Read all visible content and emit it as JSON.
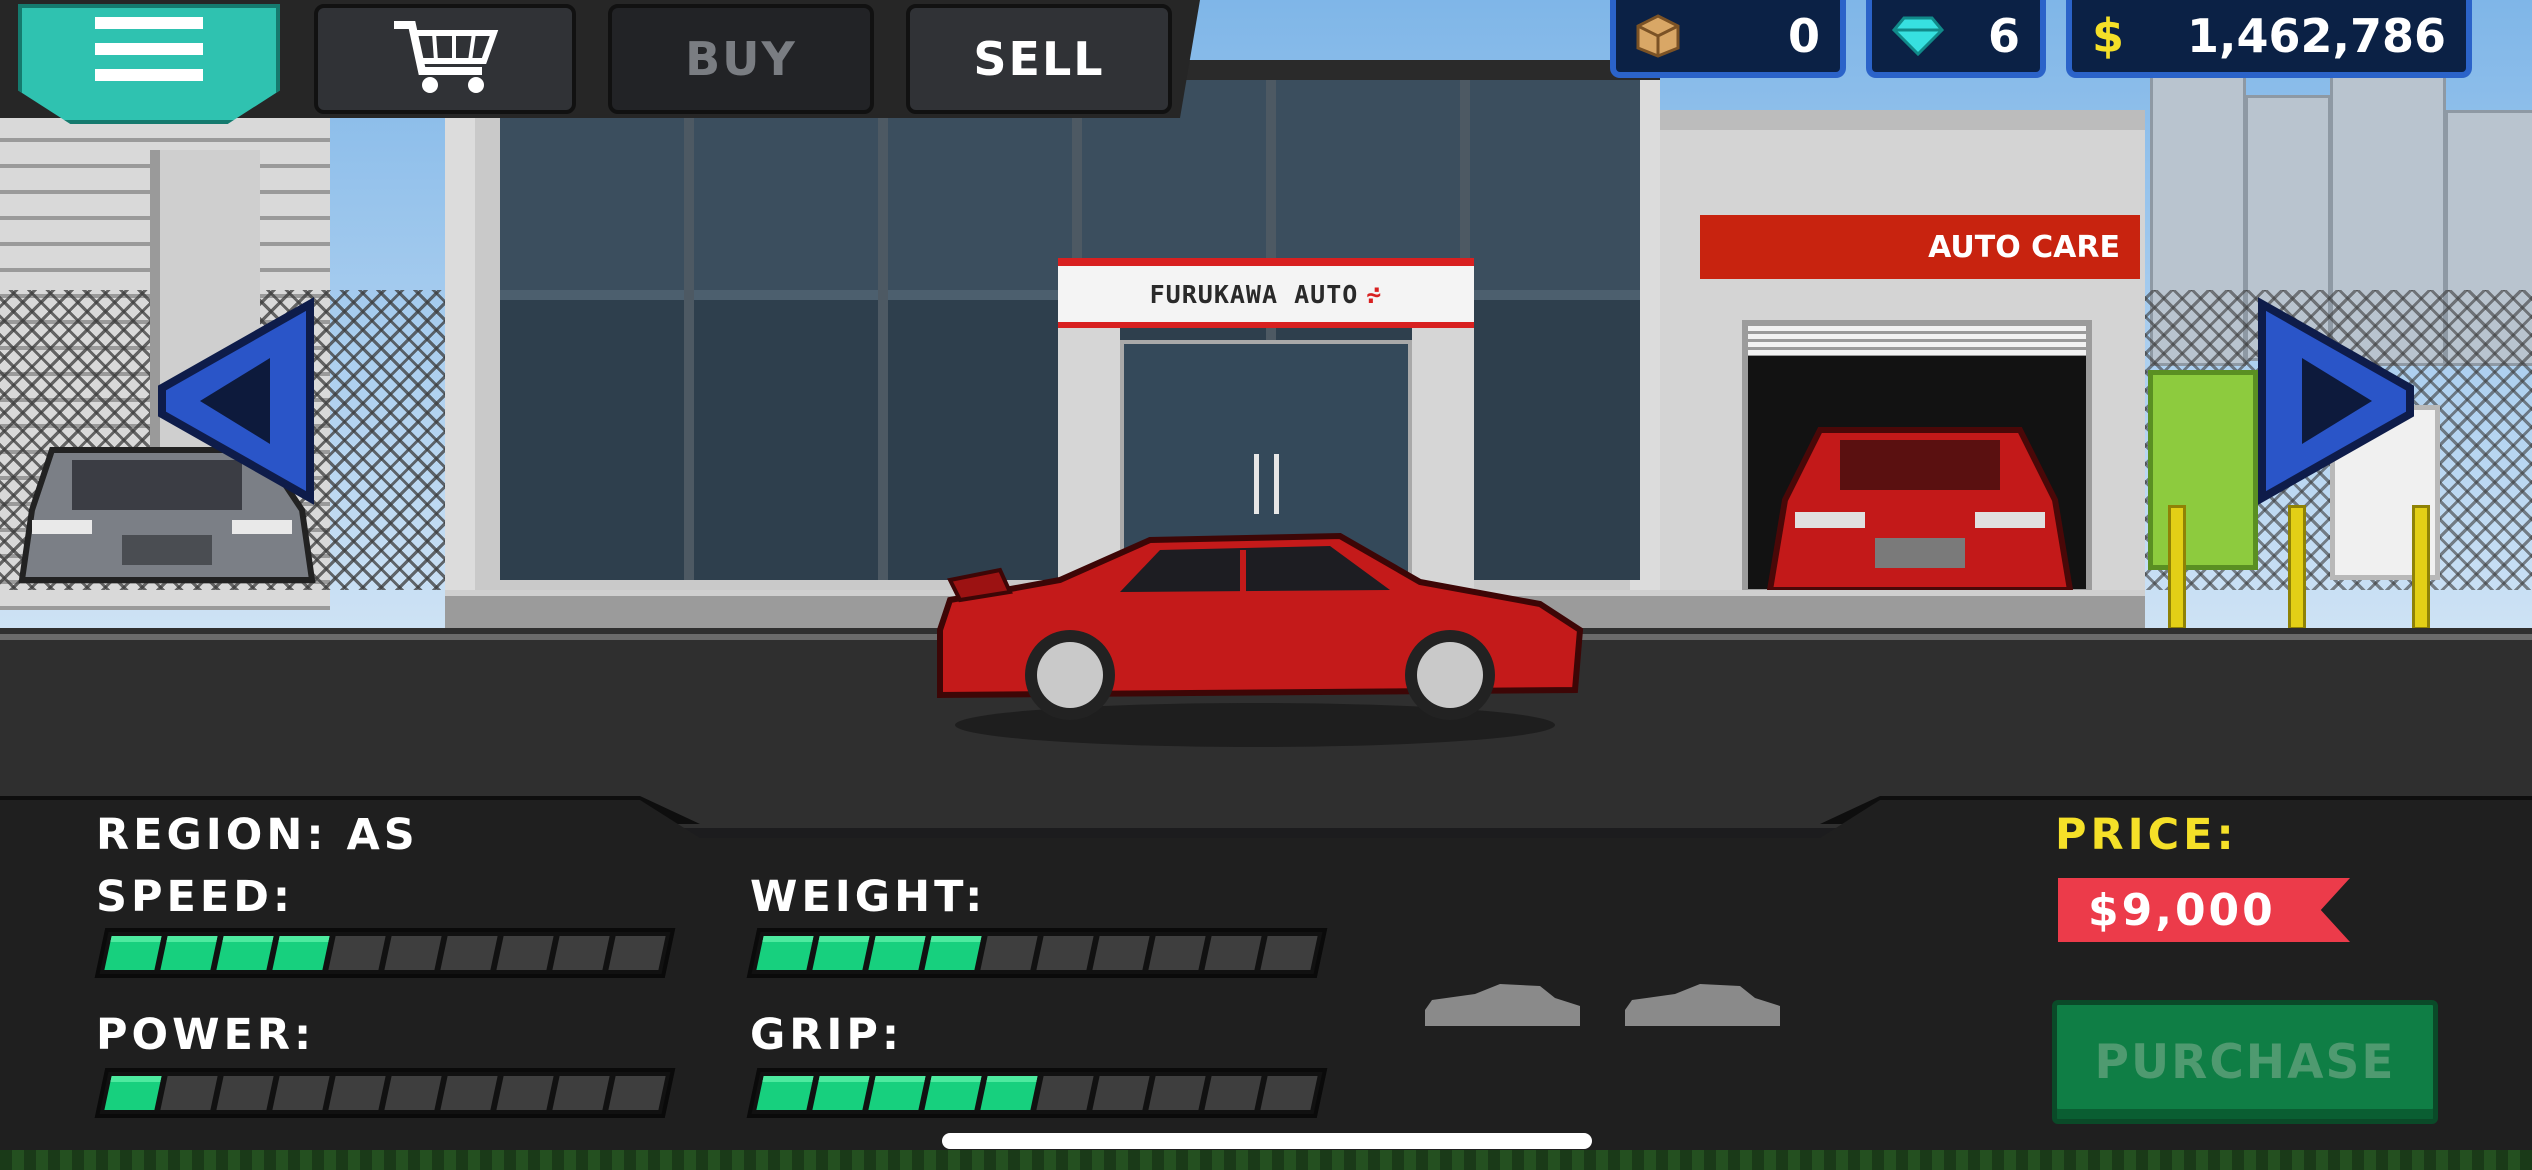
{
  "topbar": {
    "buy_label": "BUY",
    "sell_label": "SELL",
    "menu_icon": "hamburger-menu-icon",
    "cart_icon": "shopping-cart-icon"
  },
  "currency": {
    "crates": "0",
    "gems": "6",
    "cash_symbol": "$",
    "cash": "1,462,786"
  },
  "scene": {
    "dealer_sign": "FURUKAWA AUTO",
    "auto_care_sign": "AUTO CARE"
  },
  "stats": {
    "region_label": "REGION:",
    "region_value": "AS",
    "speed_label": "SPEED:",
    "weight_label": "WEIGHT:",
    "power_label": "POWER:",
    "grip_label": "GRIP:",
    "speed_level": 0.4,
    "weight_level": 0.4,
    "power_level": 0.1,
    "grip_level": 0.5
  },
  "price": {
    "label": "PRICE:",
    "value": "$9,000"
  },
  "purchase_label": "PURCHASE",
  "colors": {
    "menu_accent": "#2fc2b0",
    "stat_bar_on": "#17d07e",
    "price_label": "#f5e028",
    "price_tag": "#ec3b4a",
    "purchase_button": "#0f7e45",
    "car_body": "#c41a1a"
  }
}
